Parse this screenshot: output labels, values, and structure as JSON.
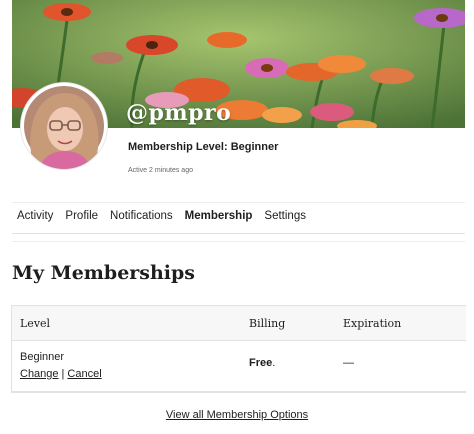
{
  "profile": {
    "username": "@pmpro",
    "membership_level_line": "Membership Level: Beginner",
    "active_status": "Active 2 minutes ago"
  },
  "nav": {
    "tabs": [
      {
        "label": "Activity"
      },
      {
        "label": "Profile"
      },
      {
        "label": "Notifications"
      },
      {
        "label": "Membership",
        "current": true
      },
      {
        "label": "Settings"
      }
    ]
  },
  "page": {
    "title": "My Memberships"
  },
  "table": {
    "headers": [
      "Level",
      "Billing",
      "Expiration"
    ],
    "rows": [
      {
        "level": "Beginner",
        "change_label": "Change",
        "separator": "|",
        "cancel_label": "Cancel",
        "billing": "Free",
        "billing_suffix": ".",
        "expiration": "—"
      }
    ]
  },
  "footer": {
    "view_all_label": "View all Membership Options"
  }
}
